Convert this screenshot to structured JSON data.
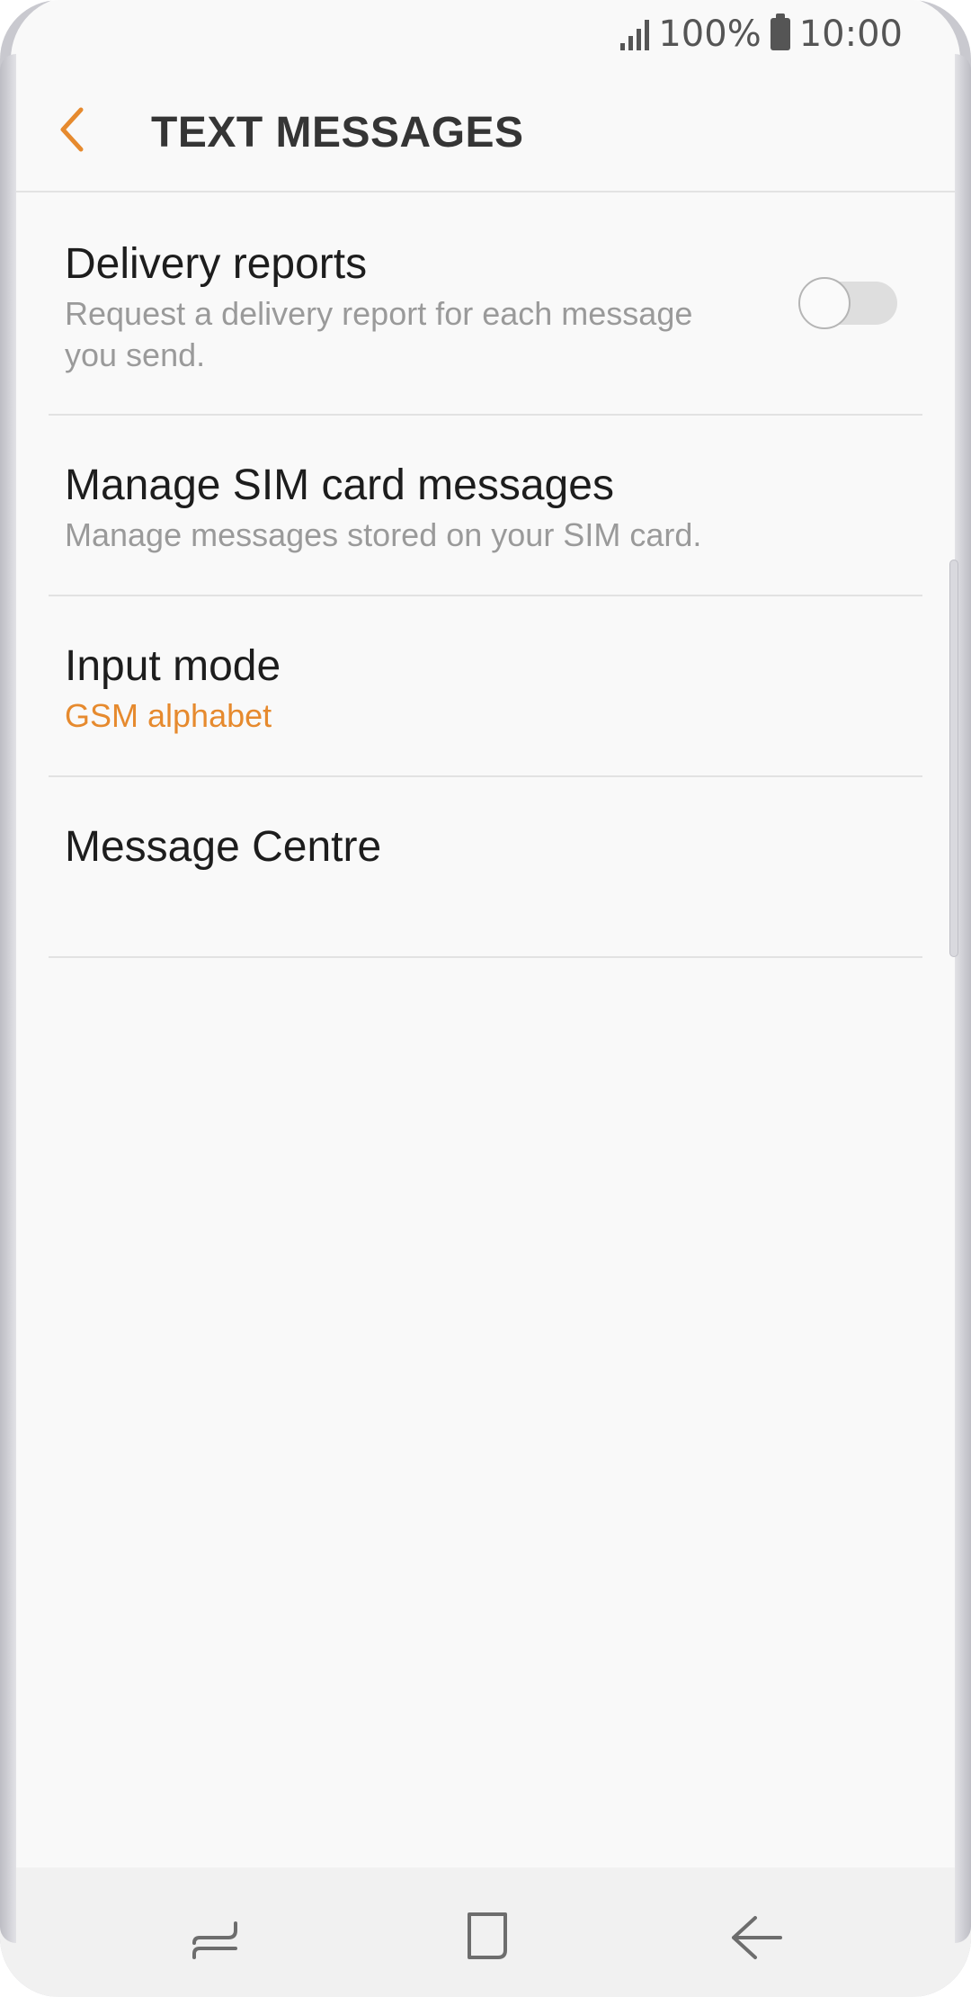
{
  "status_bar": {
    "battery_percent": "100%",
    "time": "10:00",
    "icons": [
      "signal-icon",
      "battery-icon"
    ]
  },
  "app_bar": {
    "title": "TEXT MESSAGES",
    "back_icon": "back-arrow-icon",
    "accent_color": "#e68a2e"
  },
  "settings": [
    {
      "title": "Delivery reports",
      "subtitle_lines": [
        "Request a delivery report for each message",
        "you send."
      ],
      "toggle": "off"
    },
    {
      "title": "Manage SIM card messages",
      "subtitle": "Manage messages stored on your SIM card."
    },
    {
      "title": "Input mode",
      "value": "GSM alphabet"
    },
    {
      "title": "Message Centre"
    }
  ],
  "nav_bar": {
    "buttons": [
      "recent-apps-icon",
      "home-icon",
      "back-icon"
    ]
  }
}
